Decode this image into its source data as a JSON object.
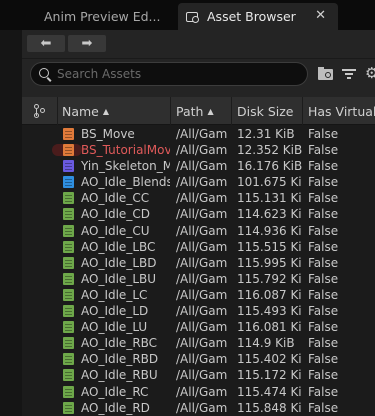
{
  "tabs": {
    "anim_preview": "Anim Preview Ed...",
    "asset_browser": "Asset Browser",
    "close_glyph": "✕"
  },
  "nav": {
    "back": "⬅",
    "forward": "➡"
  },
  "search": {
    "placeholder": "Search Assets",
    "value": ""
  },
  "columns": {
    "name": "Name",
    "path": "Path",
    "disk_size": "Disk Size",
    "has_virtual": "Has Virtuali"
  },
  "sort": {
    "name_arrow": "▲",
    "path_arrow": "▲"
  },
  "colors": {
    "blendspace": "#e07a3a",
    "skeleton": "#6a5adf",
    "blendspace_1d": "#2f8fe0",
    "aim_offset": "#6ea84a",
    "warning_text": "#e05a5a"
  },
  "rows": [
    {
      "icon": "blendspace-asset-icon",
      "color": "#e07a3a",
      "name": "BS_Move",
      "path": "/All/Gam",
      "size": "12.31 KiB",
      "virtual": "False",
      "warn": false
    },
    {
      "icon": "blendspace-asset-icon",
      "color": "#e07a3a",
      "name": "BS_TutorialMov",
      "path": "/All/Gam",
      "size": "12.352 KiB",
      "virtual": "False",
      "warn": true
    },
    {
      "icon": "skeleton-asset-icon",
      "color": "#6a5adf",
      "name": "Yin_Skeleton_M",
      "path": "/All/Gam",
      "size": "16.176 KiB",
      "virtual": "False",
      "warn": false
    },
    {
      "icon": "blendspace1d-asset-icon",
      "color": "#2f8fe0",
      "name": "AO_Idle_Blends",
      "path": "/All/Gam",
      "size": "101.675 Ki",
      "virtual": "False",
      "warn": false
    },
    {
      "icon": "animation-asset-icon",
      "color": "#6ea84a",
      "name": "AO_Idle_CC",
      "path": "/All/Gam",
      "size": "115.131 Ki",
      "virtual": "False",
      "warn": false
    },
    {
      "icon": "animation-asset-icon",
      "color": "#6ea84a",
      "name": "AO_Idle_CD",
      "path": "/All/Gam",
      "size": "114.623 Ki",
      "virtual": "False",
      "warn": false
    },
    {
      "icon": "animation-asset-icon",
      "color": "#6ea84a",
      "name": "AO_Idle_CU",
      "path": "/All/Gam",
      "size": "114.936 Ki",
      "virtual": "False",
      "warn": false
    },
    {
      "icon": "animation-asset-icon",
      "color": "#6ea84a",
      "name": "AO_Idle_LBC",
      "path": "/All/Gam",
      "size": "115.515 Ki",
      "virtual": "False",
      "warn": false
    },
    {
      "icon": "animation-asset-icon",
      "color": "#6ea84a",
      "name": "AO_Idle_LBD",
      "path": "/All/Gam",
      "size": "115.995 Ki",
      "virtual": "False",
      "warn": false
    },
    {
      "icon": "animation-asset-icon",
      "color": "#6ea84a",
      "name": "AO_Idle_LBU",
      "path": "/All/Gam",
      "size": "115.792 Ki",
      "virtual": "False",
      "warn": false
    },
    {
      "icon": "animation-asset-icon",
      "color": "#6ea84a",
      "name": "AO_Idle_LC",
      "path": "/All/Gam",
      "size": "116.087 Ki",
      "virtual": "False",
      "warn": false
    },
    {
      "icon": "animation-asset-icon",
      "color": "#6ea84a",
      "name": "AO_Idle_LD",
      "path": "/All/Gam",
      "size": "115.493 Ki",
      "virtual": "False",
      "warn": false
    },
    {
      "icon": "animation-asset-icon",
      "color": "#6ea84a",
      "name": "AO_Idle_LU",
      "path": "/All/Gam",
      "size": "116.081 Ki",
      "virtual": "False",
      "warn": false
    },
    {
      "icon": "animation-asset-icon",
      "color": "#6ea84a",
      "name": "AO_Idle_RBC",
      "path": "/All/Gam",
      "size": "114.9 KiB",
      "virtual": "False",
      "warn": false
    },
    {
      "icon": "animation-asset-icon",
      "color": "#6ea84a",
      "name": "AO_Idle_RBD",
      "path": "/All/Gam",
      "size": "115.402 Ki",
      "virtual": "False",
      "warn": false
    },
    {
      "icon": "animation-asset-icon",
      "color": "#6ea84a",
      "name": "AO_Idle_RBU",
      "path": "/All/Gam",
      "size": "115.172 Ki",
      "virtual": "False",
      "warn": false
    },
    {
      "icon": "animation-asset-icon",
      "color": "#6ea84a",
      "name": "AO_Idle_RC",
      "path": "/All/Gam",
      "size": "115.474 Ki",
      "virtual": "False",
      "warn": false
    },
    {
      "icon": "animation-asset-icon",
      "color": "#6ea84a",
      "name": "AO_Idle_RD",
      "path": "/All/Gam",
      "size": "115.848 Ki",
      "virtual": "False",
      "warn": false
    }
  ]
}
